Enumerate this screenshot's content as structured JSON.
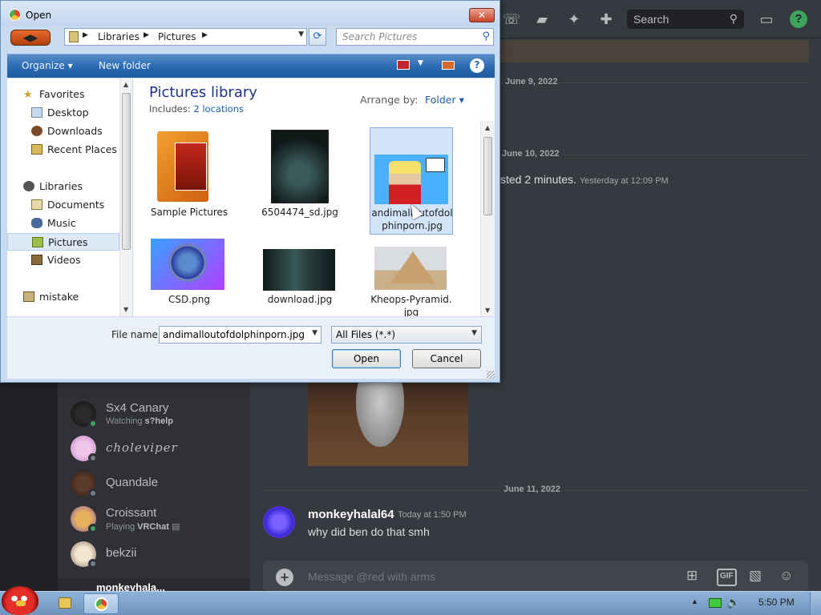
{
  "discord": {
    "search_placeholder": "Search",
    "help_glyph": "?",
    "dates": [
      "June 9, 2022",
      "June 10, 2022",
      "June 11, 2022"
    ],
    "fragment_text": "sted 2 minutes.",
    "fragment_time": "Yesterday at 12:09 PM",
    "members": [
      {
        "name": "Sx4 Canary",
        "activity_prefix": "Watching ",
        "activity_bold": "s?help",
        "status": "online"
      },
      {
        "name": "choleviper",
        "activity_prefix": "",
        "activity_bold": "",
        "status": "offline"
      },
      {
        "name": "Quandale",
        "activity_prefix": "",
        "activity_bold": "",
        "status": "offline"
      },
      {
        "name": "Croissant",
        "activity_prefix": "Playing ",
        "activity_bold": "VRChat",
        "status": "online"
      },
      {
        "name": "bekzii",
        "activity_prefix": "",
        "activity_bold": "",
        "status": "offline"
      }
    ],
    "message": {
      "author": "monkeyhalal64",
      "time": "Today at 1:50 PM",
      "text": "why did ben do that smh"
    },
    "composer_placeholder": "Message @red with arms",
    "composer_gif": "GIF",
    "user_panel_name": "monkeyhala..."
  },
  "dialog": {
    "title": "Open",
    "close_glyph": "✕",
    "breadcrumbs": [
      "Libraries",
      "Pictures"
    ],
    "search_placeholder": "Search Pictures",
    "toolbar": {
      "organize": "Organize ▾",
      "new_folder": "New folder",
      "help": "?"
    },
    "nav": {
      "favorites_label": "Favorites",
      "favorites": [
        "Desktop",
        "Downloads",
        "Recent Places"
      ],
      "libraries_label": "Libraries",
      "libraries": [
        "Documents",
        "Music",
        "Pictures",
        "Videos"
      ],
      "selected": "Pictures",
      "extra": "mistake"
    },
    "library": {
      "title": "Pictures library",
      "includes_prefix": "Includes:",
      "includes_link": "2 locations",
      "arrange_label": "Arrange by:",
      "arrange_value": "Folder ▾"
    },
    "files": [
      {
        "name": "Sample Pictures",
        "kind": "folder"
      },
      {
        "name": "6504474_sd.jpg",
        "kind": "poster"
      },
      {
        "name": "andimalloutofdolphinporn.jpg",
        "kind": "comic",
        "selected": true
      },
      {
        "name": "CSD.png",
        "kind": "badge"
      },
      {
        "name": "download.jpg",
        "kind": "face"
      },
      {
        "name": "Kheops-Pyramid.jpg",
        "kind": "pyramid"
      }
    ],
    "file_name_label": "File name:",
    "file_name_value": "andimalloutofdolphinporn.jpg",
    "file_type_value": "All Files (*.*)",
    "open_label": "Open",
    "cancel_label": "Cancel"
  },
  "taskbar": {
    "clock": "5:50 PM"
  },
  "colors": {
    "discord_bg": "#36393f",
    "online": "#3ba55d",
    "dialog_accent": "#2c6cb3"
  }
}
